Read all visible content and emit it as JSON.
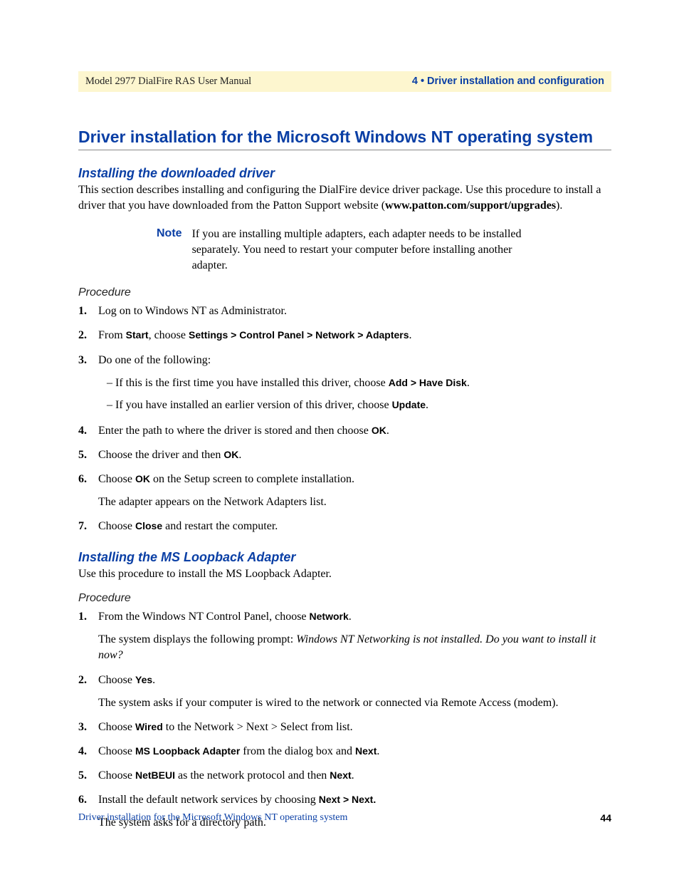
{
  "header": {
    "left": "Model 2977 DialFire RAS User Manual",
    "right": "4 • Driver installation and configuration"
  },
  "title": "Driver installation for the Microsoft Windows NT operating system",
  "section1": {
    "heading": "Installing the downloaded driver",
    "intro_a": "This section describes installing and configuring the DialFire device driver package. Use this procedure to install a driver that you have downloaded from the Patton Support website (",
    "intro_bold": "www.patton.com/support/upgrades",
    "intro_b": ").",
    "note_label": "Note",
    "note_text": "If you are installing multiple adapters, each adapter needs to be installed separately. You need to restart your computer before installing another adapter.",
    "procedure_label": "Procedure",
    "steps": {
      "s1": "Log on to Windows NT as Administrator.",
      "s2_a": "From ",
      "s2_b1": "Start",
      "s2_c": ", choose ",
      "s2_b2": "Settings > Control Panel > Network > Adapters",
      "s2_d": ".",
      "s3": "Do one of the following:",
      "s3_sub1_a": "– If this is the first time you have installed this driver, choose ",
      "s3_sub1_b": "Add > Have Disk",
      "s3_sub1_c": ".",
      "s3_sub2_a": "– If you have installed an earlier version of this driver, choose ",
      "s3_sub2_b": "Update",
      "s3_sub2_c": ".",
      "s4_a": "Enter the path to where the driver is stored and then choose ",
      "s4_b": "OK",
      "s4_c": ".",
      "s5_a": "Choose the driver and then ",
      "s5_b": "OK",
      "s5_c": ".",
      "s6_a": "Choose ",
      "s6_b": "OK",
      "s6_c": " on the Setup screen to complete installation.",
      "s6_follow": "The adapter appears on the Network Adapters list.",
      "s7_a": "Choose ",
      "s7_b": "Close",
      "s7_c": " and restart the computer."
    }
  },
  "section2": {
    "heading": "Installing the MS Loopback Adapter",
    "intro": "Use this procedure to install the MS Loopback Adapter.",
    "procedure_label": "Procedure",
    "steps": {
      "s1_a": "From the Windows NT Control Panel, choose ",
      "s1_b": "Network",
      "s1_c": ".",
      "s1_follow_a": "The system displays the following prompt: ",
      "s1_follow_i": "Windows NT Networking is not installed. Do you want to install it now?",
      "s2_a": "Choose ",
      "s2_b": "Yes",
      "s2_c": ".",
      "s2_follow": "The system asks if your computer is wired to the network or connected via Remote Access (modem).",
      "s3_a": "Choose ",
      "s3_b": "Wired",
      "s3_c": " to the Network > Next > Select from list.",
      "s4_a": "Choose ",
      "s4_b": "MS Loopback Adapter",
      "s4_c": " from the dialog box and ",
      "s4_d": "Next",
      "s4_e": ".",
      "s5_a": "Choose ",
      "s5_b": "NetBEUI",
      "s5_c": " as the network protocol and then ",
      "s5_d": "Next",
      "s5_e": ".",
      "s6_a": "Install the default network services by choosing ",
      "s6_b": "Next > Next.",
      "s6_follow": "The system asks for a directory path."
    }
  },
  "footer": {
    "left": "Driver installation for the Microsoft Windows NT operating system",
    "page": "44"
  }
}
